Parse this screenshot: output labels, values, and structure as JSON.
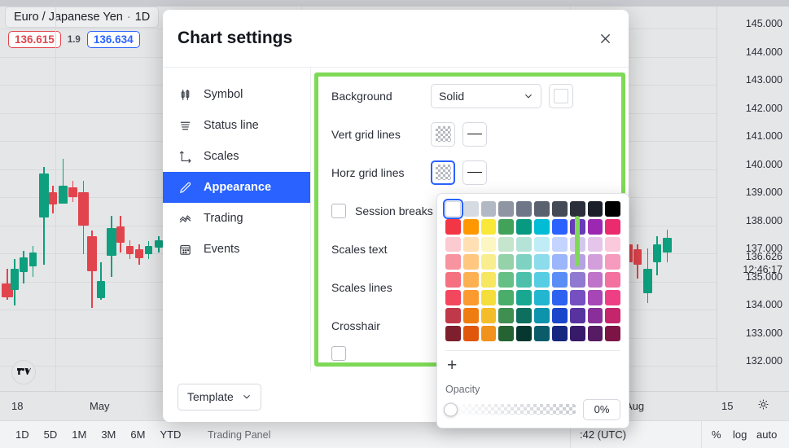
{
  "chart": {
    "symbol_title": "Euro / Japanese Yen",
    "interval": "1D",
    "separator": "·",
    "bid": "136.615",
    "spread": "1.9",
    "ask": "136.634",
    "price_ticks": [
      "145.000",
      "144.000",
      "143.000",
      "142.000",
      "141.000",
      "140.000",
      "139.000",
      "138.000",
      "137.000",
      "135.000",
      "134.000",
      "133.000",
      "132.000"
    ],
    "current_price": "136.626",
    "current_time": "12:46:17",
    "time_labels": [
      "18",
      "May",
      "Aug",
      "15"
    ],
    "logo_name": "tradingview-logo",
    "up_color": "#0e9f7e",
    "down_color": "#e1444d",
    "bg_color": "#e5e6e7"
  },
  "bottom_bar": {
    "ranges": [
      "1D",
      "5D",
      "1M",
      "3M",
      "6M",
      "YTD"
    ],
    "trading_panel_label": "Trading Panel",
    "clock": ":42 (UTC)",
    "percent": "%",
    "log": "log",
    "auto": "auto",
    "gear_icon": "gear-icon"
  },
  "dialog": {
    "title": "Chart settings",
    "close_icon": "close-icon",
    "nav": [
      {
        "label": "Symbol",
        "icon": "candlestick-icon",
        "active": false
      },
      {
        "label": "Status line",
        "icon": "status-line-icon",
        "active": false
      },
      {
        "label": "Scales",
        "icon": "axes-icon",
        "active": false
      },
      {
        "label": "Appearance",
        "icon": "pencil-icon",
        "active": true
      },
      {
        "label": "Trading",
        "icon": "zigzag-icon",
        "active": false
      },
      {
        "label": "Events",
        "icon": "calendar-icon",
        "active": false
      }
    ],
    "rows": [
      {
        "label": "Background",
        "type": "select-color",
        "value": "Solid"
      },
      {
        "label": "Vert grid lines",
        "type": "swatch-line",
        "selected": false
      },
      {
        "label": "Horz grid lines",
        "type": "swatch-line",
        "selected": true
      },
      {
        "label": "Session breaks",
        "type": "checkbox",
        "checked": false
      },
      {
        "label": "Scales text",
        "type": "plain"
      },
      {
        "label": "Scales lines",
        "type": "plain"
      },
      {
        "label": "Crosshair",
        "type": "plain"
      }
    ],
    "template_label": "Template",
    "highlight_color": "#7ed957",
    "accent_color": "#2962ff"
  },
  "color_picker": {
    "selected_swatch_index": 0,
    "highlight_column": 7,
    "add_label": "+",
    "opacity_label": "Opacity",
    "opacity_value": "0%",
    "rows": [
      [
        "#ffffff",
        "#d6dae2",
        "#b2b8c4",
        "#8f95a3",
        "#6e7687",
        "#5b626f",
        "#444a56",
        "#2a2f3a",
        "#1b1f2a",
        "#000000"
      ],
      [
        "#f23645",
        "#ff9800",
        "#fae838",
        "#43a25a",
        "#089981",
        "#00bcd4",
        "#2962ff",
        "#673ab7",
        "#9c27b0",
        "#ec2a6e"
      ],
      [
        "#fccbd2",
        "#ffdfb3",
        "#fcf6c2",
        "#c5e5cd",
        "#b5e3d8",
        "#bfecf5",
        "#c3d4ff",
        "#d3c8ec",
        "#e5c6ea",
        "#fbc9dc"
      ],
      [
        "#f8949f",
        "#ffc780",
        "#f8ee8f",
        "#95d1a9",
        "#7ed2c2",
        "#8ddcec",
        "#9cb6fb",
        "#b5a3e0",
        "#d39fdb",
        "#f79bbe"
      ],
      [
        "#f5717f",
        "#fdb052",
        "#f7e65f",
        "#66bf84",
        "#4cc0ab",
        "#57cde3",
        "#5b8df7",
        "#9079d0",
        "#bf73c9",
        "#f4709f"
      ],
      [
        "#f2475c",
        "#fb9a2e",
        "#f5dd3b",
        "#4aae6a",
        "#18a892",
        "#23b6d1",
        "#2e62f0",
        "#7650c0",
        "#a746b6",
        "#ef3f84"
      ],
      [
        "#c0394a",
        "#ef7c10",
        "#f5bc29",
        "#3f8f50",
        "#0d6f5e",
        "#0d93ac",
        "#1a46cc",
        "#5833a0",
        "#8a2f99",
        "#c4256b"
      ],
      [
        "#7d1f2c",
        "#e0560a",
        "#f0921c",
        "#256432",
        "#06382f",
        "#0a5c6b",
        "#15277f",
        "#381a6b",
        "#561b63",
        "#7c1546"
      ]
    ]
  }
}
